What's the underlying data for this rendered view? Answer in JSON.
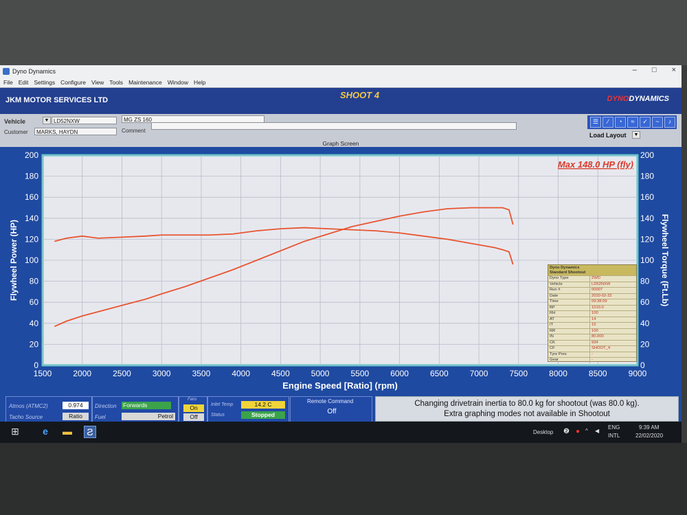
{
  "window": {
    "title": "Dyno Dynamics",
    "controls": [
      "–",
      "□",
      "×"
    ]
  },
  "menu": [
    "File",
    "Edit",
    "Settings",
    "Configure",
    "View",
    "Tools",
    "Maintenance",
    "Window",
    "Help"
  ],
  "header": {
    "company": "JKM MOTOR SERVICES LTD",
    "run_title": "SHOOT 4",
    "brand_prefix": "DYNO",
    "brand_suffix": "DYNAMICS"
  },
  "vehicle": {
    "vehicle_label": "Vehicle",
    "vehicle_value": "LD52NXW",
    "model_value": "MG ZS 160",
    "customer_label": "Customer",
    "customer_value": "MARKS, HAYDN",
    "comment_label": "Comment",
    "comment_value": "",
    "load_layout_label": "Load Layout"
  },
  "graph_screen_label": "Graph Screen",
  "chart_data": {
    "type": "line",
    "title": "",
    "annotation": "Max 148.0 HP (fly)",
    "xlabel": "Engine Speed [Ratio] (rpm)",
    "ylabel_left": "Flywheel Power (HP)",
    "ylabel_right": "Flywheel Torque (Ft.Lb)",
    "xlim": [
      1500,
      9000
    ],
    "ylim_left": [
      0,
      200
    ],
    "ylim_right": [
      0,
      200
    ],
    "x_ticks": [
      1500,
      2000,
      2500,
      3000,
      3500,
      4000,
      4500,
      5000,
      5500,
      6000,
      6500,
      7000,
      7500,
      8000,
      8500,
      9000
    ],
    "y_ticks": [
      0,
      20,
      40,
      60,
      80,
      100,
      120,
      140,
      160,
      180,
      200
    ],
    "grid": true,
    "series_color": "#e8542f",
    "series": [
      {
        "x": [
          1650,
          1800,
          2000,
          2200,
          2500,
          2800,
          3000,
          3300,
          3600,
          3900,
          4200,
          4500,
          4800,
          5100,
          5400,
          5700,
          6000,
          6300,
          6600,
          6900,
          7200,
          7300,
          7380,
          7430
        ],
        "y": [
          37,
          42,
          47,
          51,
          57,
          63,
          68,
          75,
          83,
          91,
          100,
          109,
          118,
          125,
          132,
          137,
          142,
          146,
          149,
          150,
          150,
          150,
          148,
          134
        ]
      },
      {
        "x": [
          1650,
          1800,
          2000,
          2200,
          2500,
          2800,
          3000,
          3300,
          3600,
          3900,
          4200,
          4500,
          4800,
          5100,
          5400,
          5700,
          6000,
          6300,
          6600,
          6900,
          7200,
          7300,
          7380,
          7430
        ],
        "y": [
          118,
          121,
          123,
          121,
          122,
          123,
          124,
          124,
          124,
          125,
          128,
          130,
          131,
          130,
          129,
          128,
          126,
          123,
          120,
          116,
          112,
          110,
          108,
          96
        ]
      }
    ]
  },
  "run_info": {
    "title_line1": "Dyno Dynamics",
    "title_line2": "Standard Shootout",
    "rows": [
      [
        "Dyno Type",
        "2WD"
      ],
      [
        "Vehicle",
        "LD52NXW"
      ],
      [
        "Run #",
        "00007"
      ],
      [
        "Date",
        "2020-02-22"
      ],
      [
        "Time",
        "09:38:09"
      ],
      [
        "BP",
        "1010.0"
      ],
      [
        "RH",
        "100"
      ],
      [
        "AT",
        "14"
      ],
      [
        "IT",
        "15"
      ],
      [
        "RR",
        "100"
      ],
      [
        "IN",
        "80.000"
      ],
      [
        "CK",
        "934"
      ],
      [
        "CF",
        "SHOOT_4"
      ],
      [
        "Tyre Pres",
        "-"
      ],
      [
        "Gear",
        "-"
      ]
    ]
  },
  "status_bar": {
    "atmos_label": "Atmos (ATMC2)",
    "atmos_value": "0.974",
    "tacho_label": "Tacho Source",
    "tacho_value": "Ratio",
    "direction_label": "Direction",
    "direction_value": "Forwards",
    "fuel_label": "Fuel",
    "fuel_value": "Petrol",
    "fans_label": "Fans",
    "fans_on": "On",
    "fans_off": "Off",
    "inlet_label": "Inlet Temp",
    "inlet_value": "14.2 C",
    "status_label": "Status",
    "status_value": "Stopped",
    "remote_label": "Remote Command",
    "remote_value": "Off",
    "message_line1": "Changing drivetrain inertia to 80.0 kg for shootout (was 80.0 kg).",
    "message_line2": "Extra graphing modes not available in Shootout"
  },
  "taskbar": {
    "desktop_label": "Desktop",
    "lang_line1": "ENG",
    "lang_line2": "INTL",
    "time": "9:39 AM",
    "date": "22/02/2020"
  }
}
